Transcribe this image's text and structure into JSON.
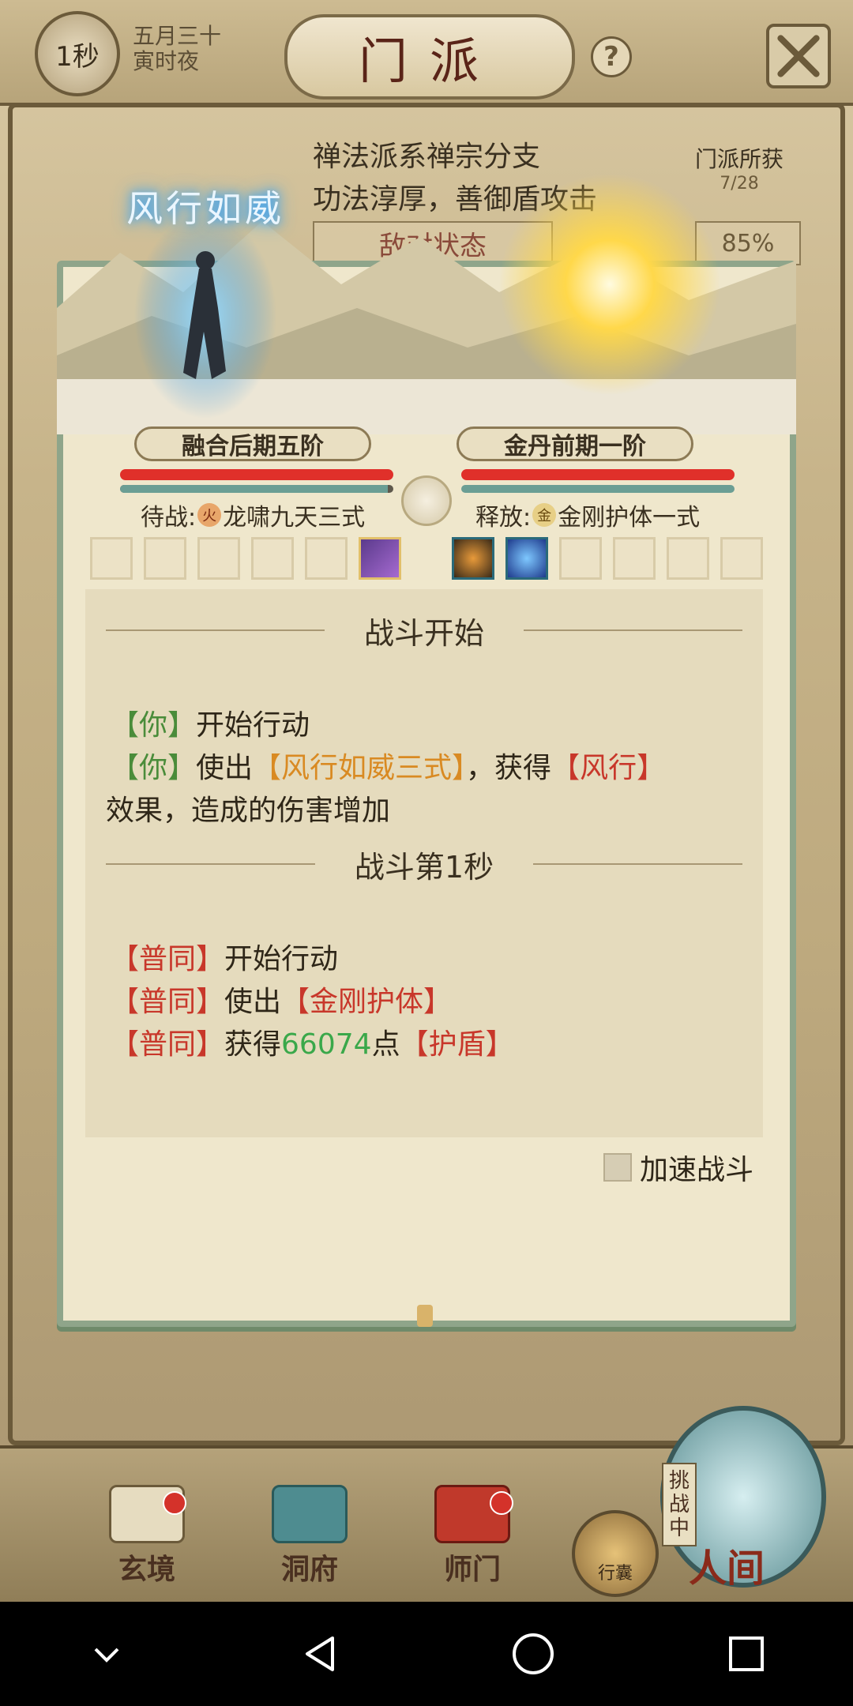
{
  "topbar": {
    "seconds_badge": "1秒",
    "date_line1": "五月三十",
    "date_line2": "寅时夜",
    "title": "门派",
    "help": "?"
  },
  "sect": {
    "desc_line1": "禅法派系禅宗分支",
    "desc_line2": "功法淳厚，善御盾攻击",
    "reward_label": "门派所获",
    "reward_count": "7/28",
    "status": "敌对状态",
    "percent": "85%"
  },
  "battle": {
    "skill_banner": "风行如威",
    "player_realm": "融合后期五阶",
    "enemy_realm": "金丹前期一阶",
    "player_hp": 1.0,
    "player_mp": 0.98,
    "enemy_hp": 1.0,
    "enemy_mp": 1.0,
    "player_skill_prefix": "待战:",
    "player_skill_element": "火",
    "player_skill_name": "龙啸九天三式",
    "enemy_skill_prefix": "释放:",
    "enemy_skill_element": "金",
    "enemy_skill_name": "金刚护体一式"
  },
  "log": {
    "section1": "战斗开始",
    "e1_who": "【你】",
    "e1_text": "开始行动",
    "e2_who": "【你】",
    "e2_a": "使出",
    "e2_skill": "【风行如威三式】",
    "e2_b": "，获得",
    "e2_buff": "【风行】",
    "e2_c": "效果，造成的伤害增加",
    "section2": "战斗第1秒",
    "e3_who": "【普同】",
    "e3_text": "开始行动",
    "e4_who": "【普同】",
    "e4_a": "使出",
    "e4_skill": "【金刚护体】",
    "e5_who": "【普同】",
    "e5_a": "获得",
    "e5_num": "66074",
    "e5_b": "点",
    "e5_buff": "【护盾】"
  },
  "speed_label": "加速战斗",
  "nav": {
    "xuanjing": "玄境",
    "dongfu": "洞府",
    "shimen": "师门",
    "bag": "行囊",
    "challenge": "挑战中",
    "world": "人间"
  }
}
